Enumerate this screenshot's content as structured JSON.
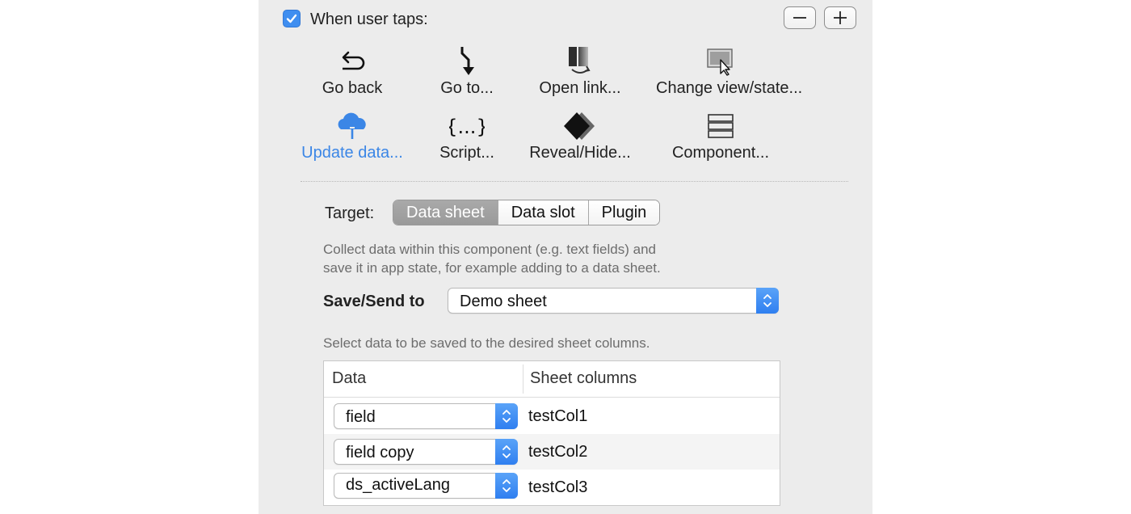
{
  "header": {
    "label": "When user taps:",
    "checked": true
  },
  "buttons": {
    "remove": "minus-icon",
    "add": "plus-icon"
  },
  "actions": [
    {
      "label": "Go back",
      "icon": "back-arrow-icon"
    },
    {
      "label": "Go to...",
      "icon": "goto-arrow-icon"
    },
    {
      "label": "Open link...",
      "icon": "open-link-icon"
    },
    {
      "label": "Change view/state...",
      "icon": "change-view-icon"
    },
    {
      "label": "Update data...",
      "icon": "cloud-upload-icon",
      "active": true
    },
    {
      "label": "Script...",
      "icon": "braces-icon"
    },
    {
      "label": "Reveal/Hide...",
      "icon": "reveal-hide-icon"
    },
    {
      "label": "Component...",
      "icon": "component-icon"
    }
  ],
  "target": {
    "label": "Target:",
    "options": [
      "Data sheet",
      "Data slot",
      "Plugin"
    ],
    "selected": "Data sheet"
  },
  "description": {
    "line1": "Collect data within this component (e.g. text fields) and",
    "line2": "save it in app state, for example adding to a data sheet."
  },
  "save_send": {
    "label": "Save/Send to",
    "value": "Demo sheet"
  },
  "select_hint": "Select data to be saved to the desired sheet columns.",
  "table": {
    "headers": [
      "Data",
      "Sheet columns"
    ],
    "rows": [
      {
        "data": "field",
        "column": "testCol1"
      },
      {
        "data": "field copy",
        "column": "testCol2"
      },
      {
        "data": "ds_activeLang",
        "column": "testCol3"
      }
    ]
  },
  "colors": {
    "accent": "#3b86e6",
    "panel": "#ececec"
  }
}
